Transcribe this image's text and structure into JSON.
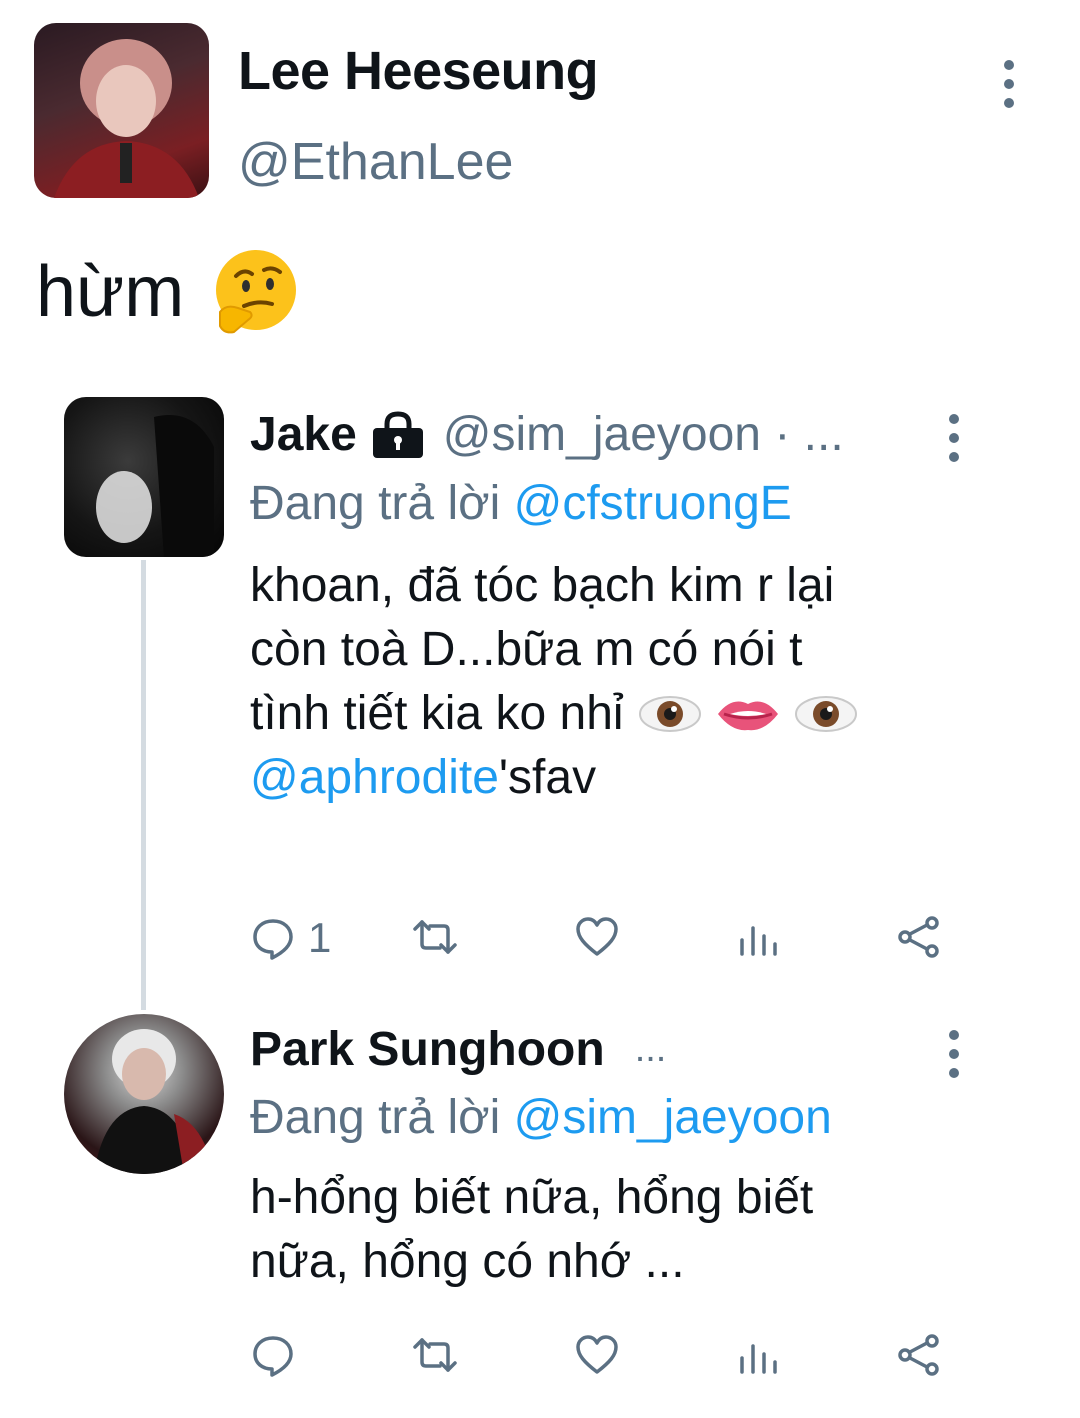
{
  "main_tweet": {
    "name": "Lee Heeseung",
    "handle": "@EthanLee",
    "text": "hừm",
    "emoji": "thinking-face"
  },
  "replies": [
    {
      "name": "Jake",
      "locked": true,
      "handle_meta": "@sim_jaeyoon · ...",
      "replying_prefix": "Đang trả lời",
      "replying_to": "@cfstruongE",
      "text_line1": "khoan, đã tóc bạch kim r lại",
      "text_line2": "còn toà D...bữa m có nói t",
      "text_line3": "tình tiết kia ko nhỉ",
      "text_emojis": [
        "eye",
        "lips",
        "eye"
      ],
      "text_mention": "@aphrodite",
      "text_suffix": "'sfav",
      "reply_count": "1"
    },
    {
      "name": "Park Sunghoon",
      "more": "...",
      "replying_prefix": "Đang trả lời",
      "replying_to": "@sim_jaeyoon",
      "text_line1": "h-hổng biết nữa, hổng biết",
      "text_line2": "nữa, hổng có nhớ ...",
      "reply_count": ""
    }
  ],
  "colors": {
    "text": "#0f1419",
    "secondary": "#5b7083",
    "link": "#1d9bf0",
    "thread_line": "#d4dbe1"
  }
}
